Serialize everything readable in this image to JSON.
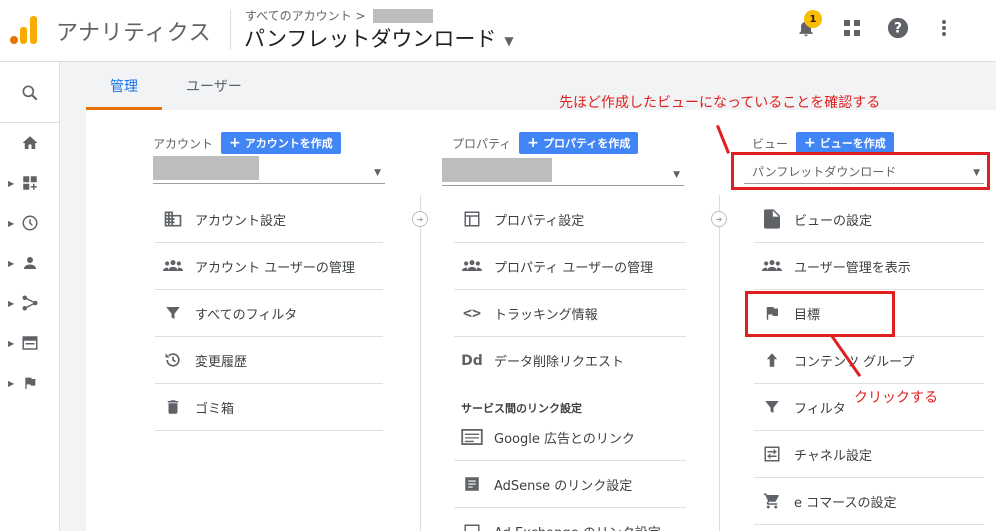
{
  "header": {
    "app_name": "アナリティクス",
    "breadcrumb": "すべてのアカウント >",
    "view_title": "パンフレットダウンロード",
    "notification_count": "1"
  },
  "tabs": [
    {
      "label": "管理",
      "active": true
    },
    {
      "label": "ユーザー",
      "active": false
    }
  ],
  "columns": {
    "account": {
      "label": "アカウント",
      "create_label": "アカウントを作成",
      "items": [
        {
          "label": "アカウント設定",
          "icon": "building-icon"
        },
        {
          "label": "アカウント ユーザーの管理",
          "icon": "users-icon"
        },
        {
          "label": "すべてのフィルタ",
          "icon": "filter-icon"
        },
        {
          "label": "変更履歴",
          "icon": "history-icon"
        },
        {
          "label": "ゴミ箱",
          "icon": "trash-icon"
        }
      ]
    },
    "property": {
      "label": "プロパティ",
      "create_label": "プロパティを作成",
      "items": [
        {
          "label": "プロパティ設定",
          "icon": "property-icon"
        },
        {
          "label": "プロパティ ユーザーの管理",
          "icon": "users-icon"
        },
        {
          "label": "トラッキング情報",
          "icon": "code-icon"
        },
        {
          "label": "データ削除リクエスト",
          "icon": "dd-icon"
        }
      ],
      "section_label": "サービス間のリンク設定",
      "link_items": [
        {
          "label": "Google 広告とのリンク",
          "icon": "ads-icon"
        },
        {
          "label": "AdSense のリンク設定",
          "icon": "adsense-icon"
        },
        {
          "label": "Ad Exchange のリンク設定",
          "icon": "adx-icon"
        }
      ]
    },
    "view": {
      "label": "ビュー",
      "create_label": "ビューを作成",
      "selected": "パンフレットダウンロード",
      "items": [
        {
          "label": "ビューの設定",
          "icon": "document-icon"
        },
        {
          "label": "ユーザー管理を表示",
          "icon": "users-icon"
        },
        {
          "label": "目標",
          "icon": "flag-icon"
        },
        {
          "label": "コンテンツ グループ",
          "icon": "content-group-icon"
        },
        {
          "label": "フィルタ",
          "icon": "filter-icon"
        },
        {
          "label": "チャネル設定",
          "icon": "channel-icon"
        },
        {
          "label": "e コマースの設定",
          "icon": "cart-icon"
        }
      ]
    }
  },
  "annotations": {
    "top_note": "先ほど作成したビューになっていることを確認する",
    "click_note": "クリックする",
    "color": "#e02020"
  },
  "colors": {
    "accent_blue": "#4285f4",
    "tab_active": "#1a73e8",
    "tab_underline": "#e8710a"
  }
}
